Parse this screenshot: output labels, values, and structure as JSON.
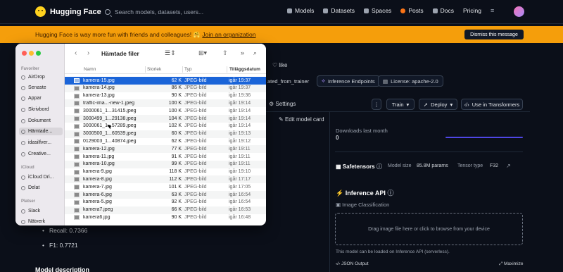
{
  "nav": {
    "brand": "Hugging Face",
    "search_placeholder": "Search models, datasets, users...",
    "links": [
      "Models",
      "Datasets",
      "Spaces",
      "Posts",
      "Docs",
      "Pricing"
    ]
  },
  "banner": {
    "text": "Hugging Face is way more fun with friends and colleagues! 🤗",
    "link": "Join an organization",
    "dismiss": "Dismiss this message"
  },
  "model": {
    "like": "like",
    "tags": [
      "ated_from_trainer",
      "Inference Endpoints",
      "License: apache-2.0"
    ],
    "settings": "Settings",
    "train": "Train",
    "deploy": "Deploy",
    "use_in": "Use in Transformers",
    "edit_card": "Edit model card",
    "downloads_label": "Downloads last month",
    "downloads_value": "0",
    "safetensors": "Safetensors",
    "model_size_label": "Model size",
    "model_size_value": "85.8M params",
    "tensor_type_label": "Tensor type",
    "tensor_type_value": "F32",
    "inference_api": "Inference API",
    "task": "Image Classification",
    "dropzone": "Drag image file here or click to browse from your device",
    "loaded_note": "This model can be loaded on Inference API (serverless).",
    "json_output": "JSON Output",
    "maximize": "Maximize",
    "metrics": [
      "Recall: 0.7366",
      "F1: 0.7721"
    ],
    "section_title": "Model description"
  },
  "finder": {
    "title": "Hämtade filer",
    "sidebar": {
      "favorites_title": "Favoriter",
      "favorites": [
        "AirDrop",
        "Senaste",
        "Appar",
        "Skrivbord",
        "Dokument",
        "Hämtade...",
        "idasilfver...",
        "Creative..."
      ],
      "icloud_title": "iCloud",
      "icloud": [
        "iCloud Dri...",
        "Delat"
      ],
      "places_title": "Platser",
      "places": [
        "Slack",
        "Nätverk"
      ]
    },
    "columns": {
      "name": "Namn",
      "size": "Storlek",
      "kind": "Typ",
      "date": "Tilläggsdatum"
    },
    "files": [
      {
        "name": "kamera-15.jpg",
        "size": "62 K",
        "kind": "JPEG-bild",
        "date": "igår 19:37"
      },
      {
        "name": "kamera-14.jpg",
        "size": "86 K",
        "kind": "JPEG-bild",
        "date": "igår 19:37"
      },
      {
        "name": "kamera-13.jpg",
        "size": "90 K",
        "kind": "JPEG-bild",
        "date": "igår 19:36"
      },
      {
        "name": "traffic-ima...-new-1.jpeg",
        "size": "100 K",
        "kind": "JPEG-bild",
        "date": "igår 19:14"
      },
      {
        "name": "3000061_1...31415.jpeg",
        "size": "100 K",
        "kind": "JPEG-bild",
        "date": "igår 19:14"
      },
      {
        "name": "3000499_1...29138.jpeg",
        "size": "104 K",
        "kind": "JPEG-bild",
        "date": "igår 19:14"
      },
      {
        "name": "3000061_1...57289.jpeg",
        "size": "102 K",
        "kind": "JPEG-bild",
        "date": "igår 19:14"
      },
      {
        "name": "3000500_1...60539.jpeg",
        "size": "60 K",
        "kind": "JPEG-bild",
        "date": "igår 19:13"
      },
      {
        "name": "0129003_1...40874.jpeg",
        "size": "62 K",
        "kind": "JPEG-bild",
        "date": "igår 19:12"
      },
      {
        "name": "kamera-12.jpg",
        "size": "77 K",
        "kind": "JPEG-bild",
        "date": "igår 19:11"
      },
      {
        "name": "kamera-11.jpg",
        "size": "91 K",
        "kind": "JPEG-bild",
        "date": "igår 19:11"
      },
      {
        "name": "kamera-10.jpg",
        "size": "99 K",
        "kind": "JPEG-bild",
        "date": "igår 19:11"
      },
      {
        "name": "kamera-9.jpg",
        "size": "118 K",
        "kind": "JPEG-bild",
        "date": "igår 19:10"
      },
      {
        "name": "kamera-8.jpg",
        "size": "112 K",
        "kind": "JPEG-bild",
        "date": "igår 17:17"
      },
      {
        "name": "kamera-7.jpg",
        "size": "101 K",
        "kind": "JPEG-bild",
        "date": "igår 17:05"
      },
      {
        "name": "kamera-6.jpg",
        "size": "63 K",
        "kind": "JPEG-bild",
        "date": "igår 16:54"
      },
      {
        "name": "kamera-5.jpg",
        "size": "92 K",
        "kind": "JPEG-bild",
        "date": "igår 16:54"
      },
      {
        "name": "kamera7.jpeg",
        "size": "66 K",
        "kind": "JPEG-bild",
        "date": "igår 16:53"
      },
      {
        "name": "kamera6.jpg",
        "size": "90 K",
        "kind": "JPEG-bild",
        "date": "igår 16:48"
      }
    ],
    "selected_index": 0
  },
  "colors": {
    "banner": "#f59e0b",
    "selection": "#1a64d8",
    "accent": "#4f46e5"
  }
}
